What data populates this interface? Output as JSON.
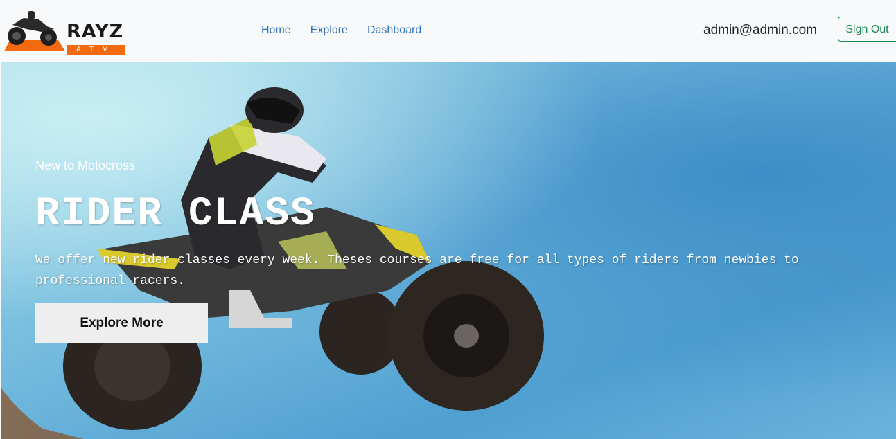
{
  "brand": {
    "name": "RAYZ",
    "sub": "ATV"
  },
  "nav": {
    "links": [
      "Home",
      "Explore",
      "Dashboard"
    ]
  },
  "user": {
    "email": "admin@admin.com",
    "signout_label": "Sign Out"
  },
  "hero": {
    "subtitle": "New to Motocross",
    "title": "RIDER CLASS",
    "description": "We offer new rider classes every week. Theses courses are free for all types of riders from newbies to professional racers.",
    "button_label": "Explore More"
  },
  "colors": {
    "brand_orange": "#f26a0f",
    "nav_link": "#2f6fb8",
    "signout": "#198754"
  }
}
